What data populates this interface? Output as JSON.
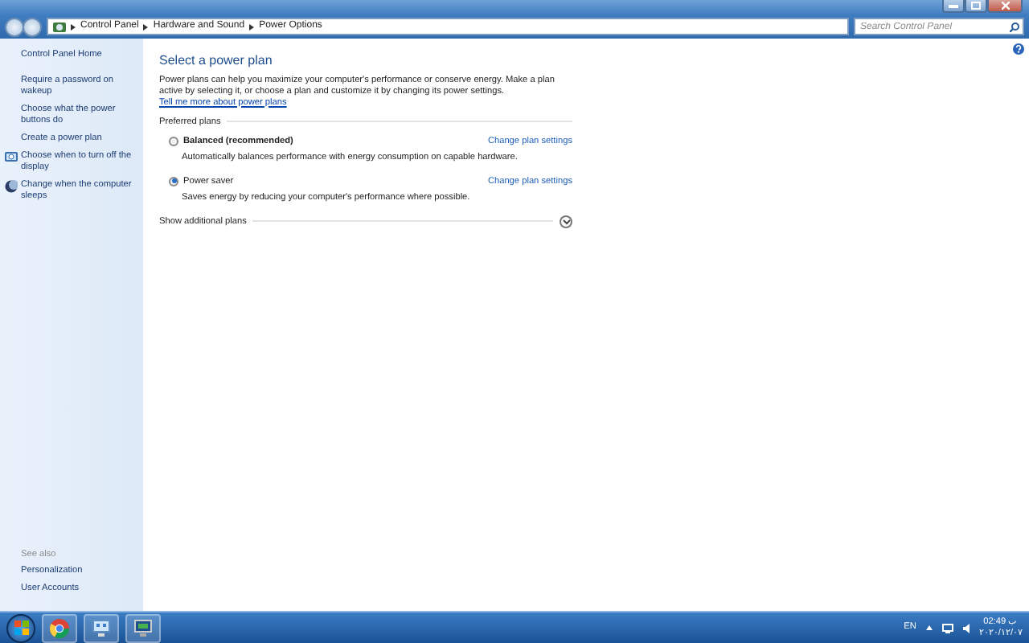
{
  "address_bar": {
    "breadcrumbs": [
      "Control Panel",
      "Hardware and Sound",
      "Power Options"
    ],
    "search_placeholder": "Search Control Panel"
  },
  "sidebar": {
    "items": [
      {
        "label": "Control Panel Home",
        "kind": "home"
      },
      {
        "label": "Require a password on wakeup",
        "kind": "link"
      },
      {
        "label": "Choose what the power buttons do",
        "kind": "link"
      },
      {
        "label": "Create a power plan",
        "kind": "link"
      },
      {
        "label": "Choose when to turn off the display",
        "kind": "monitor"
      },
      {
        "label": "Change when the computer sleeps",
        "kind": "moon"
      }
    ],
    "see_also": {
      "heading": "See also",
      "items": [
        "Personalization",
        "User Accounts"
      ]
    }
  },
  "main": {
    "title": "Select a power plan",
    "description": "Power plans can help you maximize your computer's performance or conserve energy. Make a plan active by selecting it, or choose a plan and customize it by changing its power settings.",
    "more_link": "Tell me more about power plans",
    "group_label": "Preferred plans",
    "plans": [
      {
        "name": "Balanced (recommended)",
        "description": "Automatically balances performance with energy consumption on capable hardware.",
        "selected": false,
        "action": "Change plan settings"
      },
      {
        "name": "Power saver",
        "description": "Saves energy by reducing your computer's performance where possible.",
        "selected": true,
        "action": "Change plan settings"
      }
    ],
    "additional": {
      "label": "Show additional plans",
      "expanded": false
    }
  },
  "taskbar": {
    "apps": [
      {
        "kind": "browser"
      },
      {
        "kind": "network"
      },
      {
        "kind": "monitor"
      }
    ],
    "language": "EN",
    "time": "02:49 ب",
    "date": "٢٠٢٠/١٢/٠٧"
  }
}
